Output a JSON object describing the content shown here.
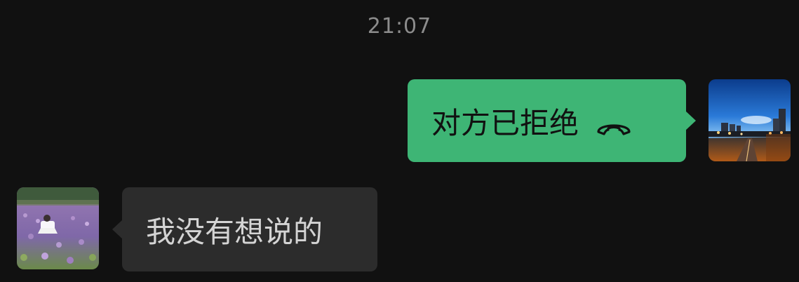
{
  "timestamp": "21:07",
  "messages": [
    {
      "sender": "self",
      "text": "对方已拒绝",
      "icon": "phone-hangup-icon",
      "bubble_color": "#3eb575",
      "text_color": "#111111"
    },
    {
      "sender": "other",
      "text": "我没有想说的",
      "bubble_color": "#2c2c2c",
      "text_color": "#d4d4d4"
    }
  ],
  "colors": {
    "background": "#111111",
    "timestamp": "#8c8c8c"
  }
}
